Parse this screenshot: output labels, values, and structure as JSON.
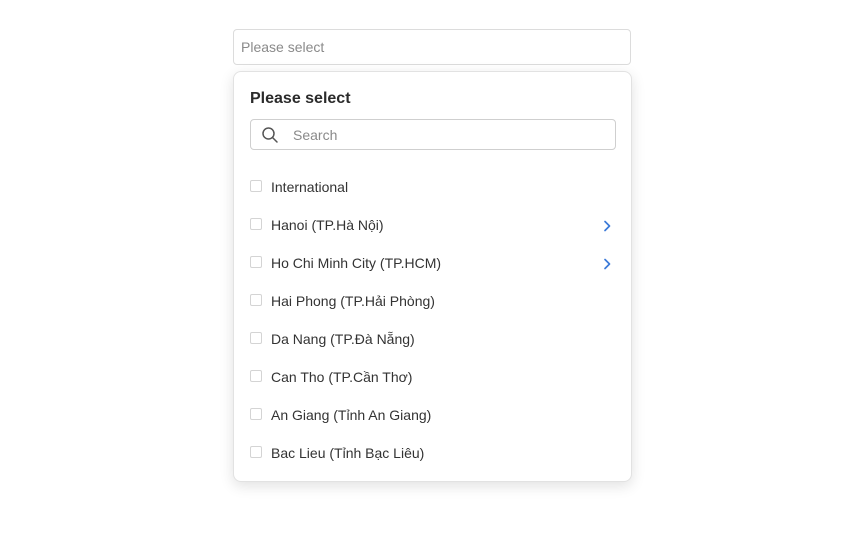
{
  "select": {
    "placeholder": "Please select"
  },
  "dropdown": {
    "title": "Please select",
    "search": {
      "placeholder": "Search",
      "value": ""
    },
    "options": [
      {
        "label": "International",
        "checked": false,
        "has_children": false
      },
      {
        "label": "Hanoi (TP.Hà Nội)",
        "checked": false,
        "has_children": true
      },
      {
        "label": "Ho Chi Minh City (TP.HCM)",
        "checked": false,
        "has_children": true
      },
      {
        "label": "Hai Phong (TP.Hải Phòng)",
        "checked": false,
        "has_children": false
      },
      {
        "label": "Da Nang (TP.Đà Nẵng)",
        "checked": false,
        "has_children": false
      },
      {
        "label": "Can Tho (TP.Cần Thơ)",
        "checked": false,
        "has_children": false
      },
      {
        "label": "An Giang (Tỉnh An Giang)",
        "checked": false,
        "has_children": false
      },
      {
        "label": "Bac Lieu (Tỉnh Bạc Liêu)",
        "checked": false,
        "has_children": false
      }
    ]
  },
  "colors": {
    "accent": "#3b7ad8",
    "border": "#dcdcdc",
    "placeholder": "#8a8a8a"
  },
  "icons": {
    "search": "search-icon",
    "expand": "chevron-right-icon"
  }
}
